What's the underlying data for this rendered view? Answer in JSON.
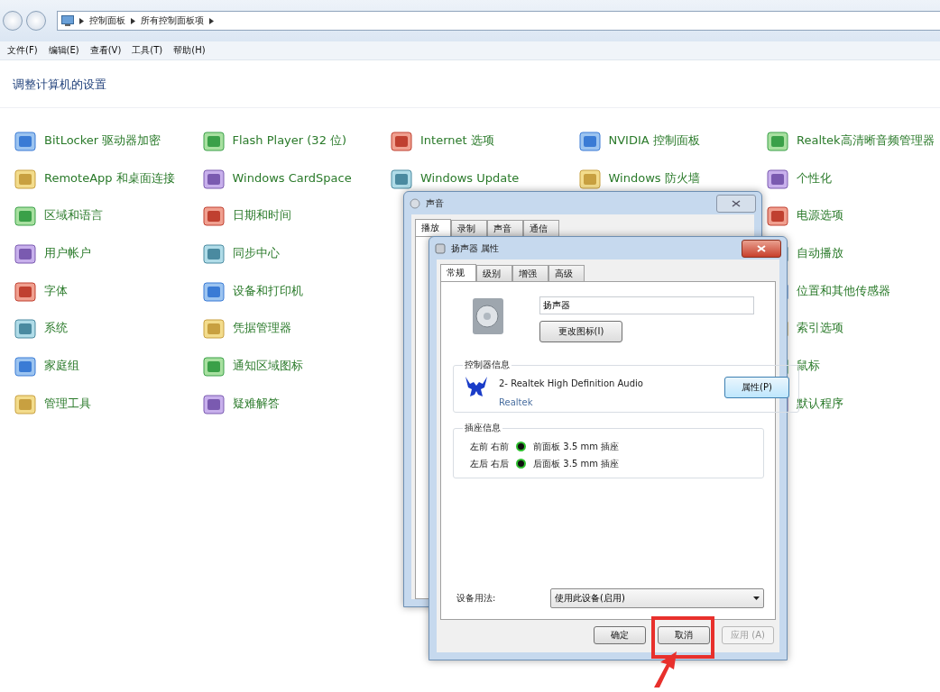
{
  "explorer": {
    "breadcrumb": [
      "控制面板",
      "所有控制面板项"
    ],
    "menu": [
      "文件(F)",
      "编辑(E)",
      "查看(V)",
      "工具(T)",
      "帮助(H)"
    ],
    "heading": "调整计算机的设置",
    "columns": [
      [
        {
          "label": "BitLocker 驱动器加密"
        },
        {
          "label": "RemoteApp 和桌面连接"
        },
        {
          "label": "区域和语言"
        },
        {
          "label": "用户帐户"
        },
        {
          "label": "字体"
        },
        {
          "label": "系统"
        },
        {
          "label": "家庭组"
        },
        {
          "label": "管理工具"
        }
      ],
      [
        {
          "label": "Flash Player (32 位)"
        },
        {
          "label": "Windows CardSpace"
        },
        {
          "label": "日期和时间"
        },
        {
          "label": "同步中心"
        },
        {
          "label": "设备和打印机"
        },
        {
          "label": "凭据管理器"
        },
        {
          "label": "通知区域图标"
        },
        {
          "label": "疑难解答"
        }
      ],
      [
        {
          "label": "Internet 选项"
        },
        {
          "label": "Windows Update"
        }
      ],
      [
        {
          "label": "NVIDIA 控制面板"
        },
        {
          "label": "Windows 防火墙"
        }
      ],
      [
        {
          "label": "Realtek高清晰音频管理器"
        },
        {
          "label": "个性化"
        },
        {
          "label": "电源选项"
        },
        {
          "label": "自动播放"
        },
        {
          "label": "位置和其他传感器"
        },
        {
          "label": "索引选项"
        },
        {
          "label": "鼠标"
        },
        {
          "label": "默认程序"
        }
      ]
    ]
  },
  "sound_dialog": {
    "title": "声音",
    "tabs": [
      {
        "label": "播放",
        "selected": true
      },
      {
        "label": "录制",
        "selected": false
      },
      {
        "label": "声音",
        "selected": false
      },
      {
        "label": "通信",
        "selected": false
      }
    ]
  },
  "speaker_dialog": {
    "title": "扬声器 属性",
    "tabs": [
      {
        "label": "常规",
        "selected": true
      },
      {
        "label": "级别",
        "selected": false
      },
      {
        "label": "增强",
        "selected": false
      },
      {
        "label": "高级",
        "selected": false
      }
    ],
    "name": "扬声器",
    "change_icon_button": "更改图标(I)",
    "controller": {
      "legend": "控制器信息",
      "device": "2- Realtek High Definition Audio",
      "vendor": "Realtek",
      "button": "属性(P)"
    },
    "jacks": {
      "legend": "插座信息",
      "rows": [
        {
          "channels": "左前 右前",
          "jack": "前面板 3.5 mm 插座"
        },
        {
          "channels": "左后 右后",
          "jack": "后面板 3.5 mm 插座"
        }
      ]
    },
    "usage": {
      "label": "设备用法:",
      "value": "使用此设备(启用)"
    },
    "buttons": [
      {
        "label": "确定",
        "disabled": false,
        "highlighted": false
      },
      {
        "label": "取消",
        "disabled": false,
        "highlighted": true
      },
      {
        "label": "应用 (A)",
        "disabled": true,
        "highlighted": false
      }
    ]
  }
}
